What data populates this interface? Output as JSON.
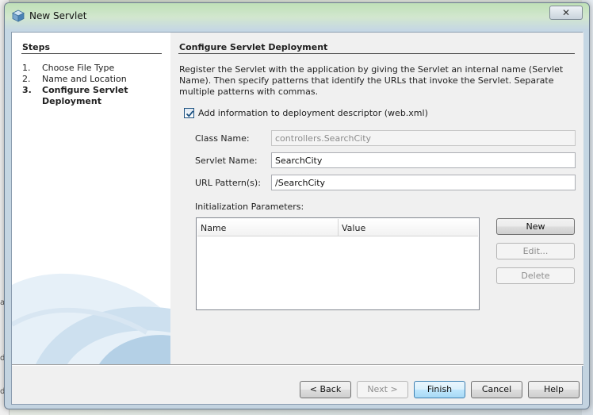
{
  "window": {
    "title": "New Servlet"
  },
  "steps": {
    "title": "Steps",
    "items": [
      {
        "num": "1.",
        "label": "Choose File Type"
      },
      {
        "num": "2.",
        "label": "Name and Location"
      },
      {
        "num": "3.",
        "label": "Configure Servlet",
        "label2": "Deployment",
        "current": true
      }
    ]
  },
  "panel": {
    "title": "Configure Servlet Deployment",
    "description": "Register the Servlet with the application by giving the Servlet an internal name (Servlet Name). Then specify patterns that identify the URLs that invoke the Servlet. Separate multiple patterns with commas.",
    "checkbox_label": "Add information to deployment descriptor (web.xml)",
    "checkbox_checked": true,
    "class_name_label": "Class Name:",
    "class_name_value": "controllers.SearchCity",
    "servlet_name_label": "Servlet Name:",
    "servlet_name_value": "SearchCity",
    "url_pattern_label": "URL Pattern(s):",
    "url_pattern_value": "/SearchCity",
    "init_params_label": "Initialization Parameters:",
    "table_columns": [
      "Name",
      "Value"
    ],
    "buttons": {
      "new": "New",
      "edit": "Edit...",
      "delete": "Delete"
    }
  },
  "footer": {
    "back": "< Back",
    "next": "Next >",
    "finish": "Finish",
    "cancel": "Cancel",
    "help": "Help"
  },
  "icons": {
    "window": "netbeans-cube-icon",
    "close": "close-icon",
    "check": "checkmark-icon"
  },
  "colors": {
    "accent": "#3c7fb1",
    "check": "#1c5180"
  }
}
